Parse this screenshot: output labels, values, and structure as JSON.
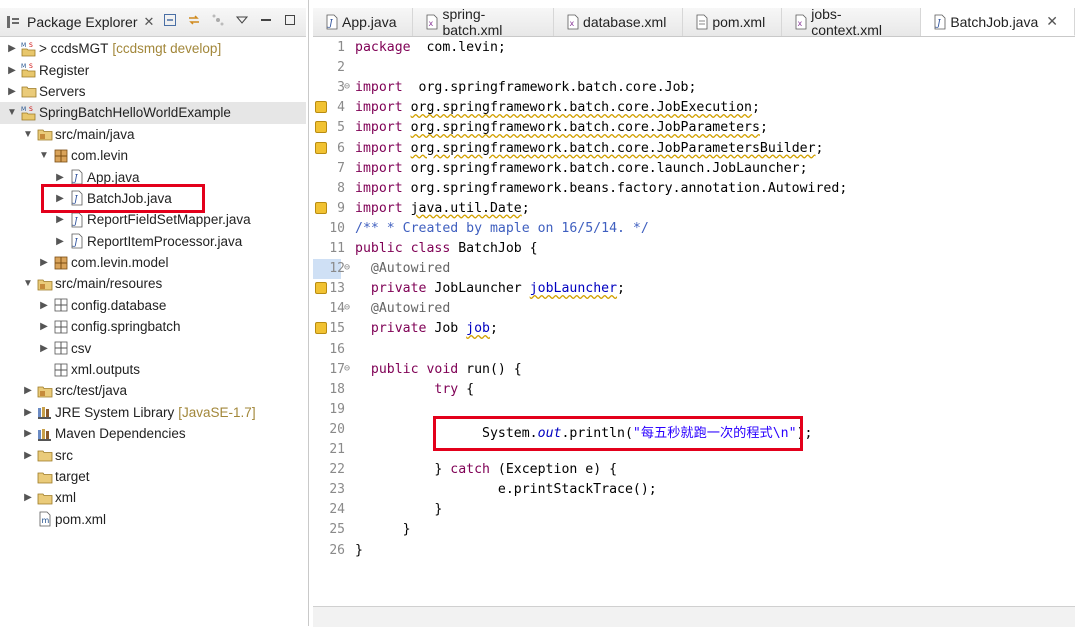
{
  "explorer": {
    "title": "Package Explorer",
    "close_glyph": "✕",
    "toolbar_icons": [
      "collapse-all-icon",
      "link-editor-icon",
      "focus-icon",
      "view-menu-icon",
      "minimize-icon",
      "maximize-icon"
    ]
  },
  "tree": [
    {
      "label": "> ccdsMGT",
      "decor": "[ccdsmgt develop]",
      "depth": 0,
      "twisty": "▶",
      "icon": "maven-project-icon"
    },
    {
      "label": "Register",
      "decor": "",
      "depth": 0,
      "twisty": "▶",
      "icon": "maven-project-icon"
    },
    {
      "label": "Servers",
      "decor": "",
      "depth": 0,
      "twisty": "▶",
      "icon": "folder-icon"
    },
    {
      "label": "SpringBatchHelloWorldExample",
      "decor": "",
      "depth": 0,
      "twisty": "▼",
      "icon": "maven-project-icon",
      "selected": true
    },
    {
      "label": "src/main/java",
      "decor": "",
      "depth": 1,
      "twisty": "▼",
      "icon": "source-folder-icon"
    },
    {
      "label": "com.levin",
      "decor": "",
      "depth": 2,
      "twisty": "▼",
      "icon": "package-icon"
    },
    {
      "label": "App.java",
      "decor": "",
      "depth": 3,
      "twisty": "▶",
      "icon": "java-file-icon"
    },
    {
      "label": "BatchJob.java",
      "decor": "",
      "depth": 3,
      "twisty": "▶",
      "icon": "java-file-icon",
      "highlight": true
    },
    {
      "label": "ReportFieldSetMapper.java",
      "decor": "",
      "depth": 3,
      "twisty": "▶",
      "icon": "java-file-icon"
    },
    {
      "label": "ReportItemProcessor.java",
      "decor": "",
      "depth": 3,
      "twisty": "▶",
      "icon": "java-file-icon"
    },
    {
      "label": "com.levin.model",
      "decor": "",
      "depth": 2,
      "twisty": "▶",
      "icon": "package-icon"
    },
    {
      "label": "src/main/resoures",
      "decor": "",
      "depth": 1,
      "twisty": "▼",
      "icon": "source-folder-icon"
    },
    {
      "label": "config.database",
      "decor": "",
      "depth": 2,
      "twisty": "▶",
      "icon": "resource-package-icon"
    },
    {
      "label": "config.springbatch",
      "decor": "",
      "depth": 2,
      "twisty": "▶",
      "icon": "resource-package-icon"
    },
    {
      "label": "csv",
      "decor": "",
      "depth": 2,
      "twisty": "▶",
      "icon": "resource-package-icon"
    },
    {
      "label": "xml.outputs",
      "decor": "",
      "depth": 2,
      "twisty": "",
      "icon": "resource-package-icon"
    },
    {
      "label": "src/test/java",
      "decor": "",
      "depth": 1,
      "twisty": "▶",
      "icon": "source-folder-icon"
    },
    {
      "label": "JRE System Library",
      "decor": "[JavaSE-1.7]",
      "depth": 1,
      "twisty": "▶",
      "icon": "library-icon"
    },
    {
      "label": "Maven Dependencies",
      "decor": "",
      "depth": 1,
      "twisty": "▶",
      "icon": "library-icon"
    },
    {
      "label": "src",
      "decor": "",
      "depth": 1,
      "twisty": "▶",
      "icon": "folder-icon"
    },
    {
      "label": "target",
      "decor": "",
      "depth": 1,
      "twisty": "",
      "icon": "folder-icon"
    },
    {
      "label": "xml",
      "decor": "",
      "depth": 1,
      "twisty": "▶",
      "icon": "folder-icon"
    },
    {
      "label": "pom.xml",
      "decor": "",
      "depth": 1,
      "twisty": "",
      "icon": "maven-pom-icon"
    }
  ],
  "editor_tabs": [
    {
      "label": "App.java",
      "icon": "java-file-icon",
      "active": false
    },
    {
      "label": "spring-batch.xml",
      "icon": "xml-file-icon",
      "active": false
    },
    {
      "label": "database.xml",
      "icon": "xml-file-icon",
      "active": false
    },
    {
      "label": "pom.xml",
      "icon": "text-file-icon",
      "active": false
    },
    {
      "label": "jobs-context.xml",
      "icon": "xml-file-icon",
      "active": false
    },
    {
      "label": "BatchJob.java",
      "icon": "java-file-icon",
      "active": true
    }
  ],
  "code_lines": [
    {
      "n": "1",
      "fold": "",
      "warn": false,
      "tokens": [
        [
          "kw",
          "package"
        ],
        [
          "",
          "  com.levin;"
        ]
      ]
    },
    {
      "n": "2",
      "fold": "",
      "warn": false,
      "tokens": []
    },
    {
      "n": "3",
      "fold": "⊖",
      "warn": false,
      "tokens": [
        [
          "kw",
          "import"
        ],
        [
          "",
          "  org.springframework.batch.core.Job;"
        ]
      ]
    },
    {
      "n": "4",
      "fold": "",
      "warn": true,
      "tokens": [
        [
          "kw",
          "import"
        ],
        [
          "",
          " "
        ],
        [
          "sq",
          "org.springframework.batch.core.JobExecution"
        ],
        [
          "",
          ";"
        ]
      ]
    },
    {
      "n": "5",
      "fold": "",
      "warn": true,
      "tokens": [
        [
          "kw",
          "import"
        ],
        [
          "",
          " "
        ],
        [
          "sq",
          "org.springframework.batch.core.JobParameters"
        ],
        [
          "",
          ";"
        ]
      ]
    },
    {
      "n": "6",
      "fold": "",
      "warn": true,
      "tokens": [
        [
          "kw",
          "import"
        ],
        [
          "",
          " "
        ],
        [
          "sq",
          "org.springframework.batch.core.JobParametersBuilder"
        ],
        [
          "",
          ";"
        ]
      ]
    },
    {
      "n": "7",
      "fold": "",
      "warn": false,
      "tokens": [
        [
          "kw",
          "import"
        ],
        [
          "",
          " org.springframework.batch.core.launch.JobLauncher;"
        ]
      ]
    },
    {
      "n": "8",
      "fold": "",
      "warn": false,
      "tokens": [
        [
          "kw",
          "import"
        ],
        [
          "",
          " org.springframework.beans.factory.annotation.Autowired;"
        ]
      ]
    },
    {
      "n": "9",
      "fold": "",
      "warn": true,
      "tokens": [
        [
          "kw",
          "import"
        ],
        [
          "",
          " "
        ],
        [
          "sq",
          "java.util.Date"
        ],
        [
          "",
          ";"
        ]
      ]
    },
    {
      "n": "10",
      "fold": "",
      "warn": false,
      "tokens": [
        [
          "cm",
          "/** * Created by maple on 16/5/14. */"
        ]
      ]
    },
    {
      "n": "11",
      "fold": "",
      "warn": false,
      "tokens": [
        [
          "kw",
          "public class"
        ],
        [
          "",
          " BatchJob {"
        ]
      ]
    },
    {
      "n": "12",
      "fold": "⊖",
      "warn": false,
      "tokens": [
        [
          "an",
          "  @Autowired"
        ]
      ],
      "ruler": true
    },
    {
      "n": "13",
      "fold": "",
      "warn": true,
      "tokens": [
        [
          "kw",
          "  private"
        ],
        [
          "",
          " JobLauncher "
        ],
        [
          "fld sq",
          "jobLauncher"
        ],
        [
          "",
          ";"
        ]
      ]
    },
    {
      "n": "14",
      "fold": "⊖",
      "warn": false,
      "tokens": [
        [
          "an",
          "  @Autowired"
        ]
      ]
    },
    {
      "n": "15",
      "fold": "",
      "warn": true,
      "tokens": [
        [
          "kw",
          "  private"
        ],
        [
          "",
          " Job "
        ],
        [
          "fld sq",
          "job"
        ],
        [
          "",
          ";"
        ]
      ]
    },
    {
      "n": "16",
      "fold": "",
      "warn": false,
      "tokens": []
    },
    {
      "n": "17",
      "fold": "⊖",
      "warn": false,
      "tokens": [
        [
          "kw",
          "  public void"
        ],
        [
          "",
          " run() {"
        ]
      ]
    },
    {
      "n": "18",
      "fold": "",
      "warn": false,
      "tokens": [
        [
          "kw",
          "          try"
        ],
        [
          "",
          " {"
        ]
      ]
    },
    {
      "n": "19",
      "fold": "",
      "warn": false,
      "tokens": []
    },
    {
      "n": "20",
      "fold": "",
      "warn": false,
      "tokens": [
        [
          "",
          "                System."
        ],
        [
          "ital",
          "out"
        ],
        [
          "",
          ".println("
        ],
        [
          "str",
          "\"每五秒就跑一次的程式\\n\""
        ],
        [
          "",
          ");"
        ]
      ],
      "highlight": true
    },
    {
      "n": "21",
      "fold": "",
      "warn": false,
      "tokens": []
    },
    {
      "n": "22",
      "fold": "",
      "warn": false,
      "tokens": [
        [
          "",
          "          } "
        ],
        [
          "kw",
          "catch"
        ],
        [
          "",
          " (Exception "
        ],
        [
          "",
          "e"
        ],
        [
          "",
          ") {"
        ]
      ]
    },
    {
      "n": "23",
      "fold": "",
      "warn": false,
      "tokens": [
        [
          "",
          "                  e.printStackTrace();"
        ]
      ]
    },
    {
      "n": "24",
      "fold": "",
      "warn": false,
      "tokens": [
        [
          "",
          "          }"
        ]
      ]
    },
    {
      "n": "25",
      "fold": "",
      "warn": false,
      "tokens": [
        [
          "",
          "      }"
        ]
      ]
    },
    {
      "n": "26",
      "fold": "",
      "warn": false,
      "tokens": [
        [
          "",
          "}"
        ]
      ]
    }
  ]
}
